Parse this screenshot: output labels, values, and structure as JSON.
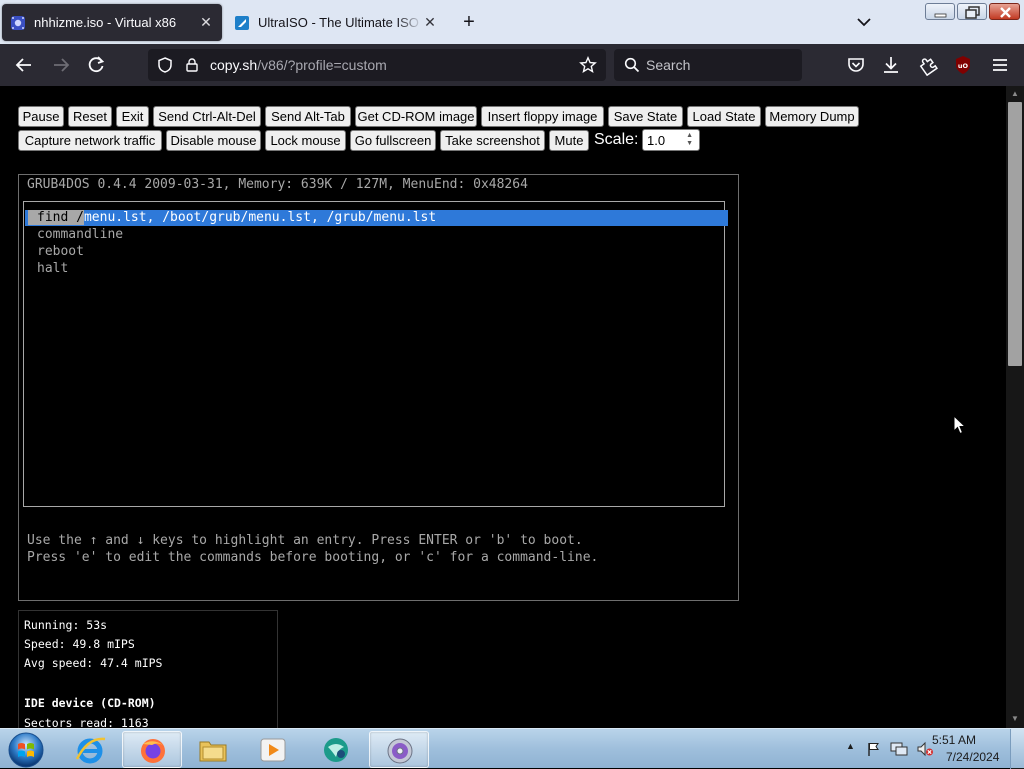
{
  "browser": {
    "tabs": [
      {
        "title": "nhhizme.iso - Virtual x86",
        "active": true,
        "favicon": "v86-icon"
      },
      {
        "title": "UltraISO - The Ultimate ISO CD",
        "active": false,
        "favicon": "ultraiso-icon"
      }
    ],
    "new_tab_label": "+",
    "url_host": "copy.sh",
    "url_path": "/v86/?profile=custom",
    "search_placeholder": "Search"
  },
  "toolbar": {
    "row1": [
      "Pause",
      "Reset",
      "Exit",
      "Send Ctrl-Alt-Del",
      "Send Alt-Tab",
      "Get CD-ROM image",
      "Insert floppy image",
      "Save State",
      "Load State",
      "Memory Dump"
    ],
    "row2": [
      "Capture network traffic",
      "Disable mouse",
      "Lock mouse",
      "Go fullscreen",
      "Take screenshot",
      "Mute"
    ],
    "scale_label": "Scale:",
    "scale_value": "1.0"
  },
  "screen": {
    "header": "GRUB4DOS 0.4.4 2009-03-31, Memory: 639K / 127M, MenuEnd: 0x48264",
    "menu_items": [
      {
        "sel_prefix": "find /",
        "rest": "menu.lst, /boot/grub/menu.lst, /grub/menu.lst"
      },
      {
        "text": "commandline"
      },
      {
        "text": "reboot"
      },
      {
        "text": "halt"
      }
    ],
    "help_line1": "Use the ↑ and ↓ keys to highlight an entry. Press ENTER or 'b' to boot.",
    "help_line2": "Press 'e' to edit the commands before booting, or 'c' for a command-line."
  },
  "stats": {
    "running": "Running: 53s",
    "speed": "Speed: 49.8 mIPS",
    "avg_speed": "Avg speed: 47.4 mIPS",
    "ide_title": "IDE device (CD-ROM)",
    "sectors_read": "Sectors read: 1163"
  },
  "taskbar": {
    "apps": [
      "internet-explorer-icon",
      "firefox-icon",
      "file-explorer-icon",
      "media-player-icon",
      "app-globe-icon",
      "disc-burner-icon"
    ],
    "active_app": "firefox-icon",
    "clock_time": "5:51 AM",
    "clock_date": "7/24/2024"
  },
  "colors": {
    "selection_blue": "#2e79d9",
    "browser_dark": "#2b2a33",
    "tab_strip": "#dee6f3"
  }
}
